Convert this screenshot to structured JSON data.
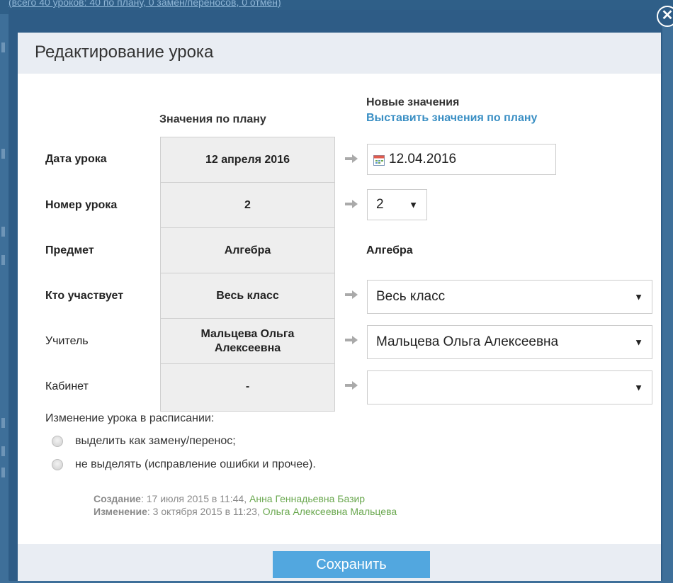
{
  "background": {
    "strip_text": "(всего 40 уроков: 40 по плану, 0 замен/переносов, 0 отмен)"
  },
  "dialog": {
    "title": "Редактирование урока",
    "close_label": "✕"
  },
  "columns": {
    "plan_header": "Значения по плану",
    "new_header": "Новые значения",
    "set_plan_link": "Выставить значения по плану"
  },
  "rows": [
    {
      "label": "Дата урока",
      "plan": "12 апреля 2016",
      "new": "12.04.2016"
    },
    {
      "label": "Номер урока",
      "plan": "2",
      "new": "2"
    },
    {
      "label": "Предмет",
      "plan": "Алгебра",
      "new": "Алгебра"
    },
    {
      "label": "Кто участвует",
      "plan": "Весь класс",
      "new": "Весь класс"
    },
    {
      "label": "Учитель",
      "plan": "Мальцева Ольга Алексеевна",
      "new": "Мальцева Ольга Алексеевна"
    },
    {
      "label": "Кабинет",
      "plan": "-",
      "new": ""
    }
  ],
  "schedule_change": {
    "title": "Изменение урока в расписании:",
    "options": [
      "выделить как замену/перенос;",
      "не выделять (исправление ошибки и прочее)."
    ]
  },
  "meta": {
    "created_label": "Создание",
    "created_value": ": 17 июля 2015 в 11:44, ",
    "created_by": "Анна Геннадьевна Базир",
    "modified_label": "Изменение",
    "modified_value": ": 3 октября 2015 в 11:23, ",
    "modified_by": "Ольга Алексеевна Мальцева"
  },
  "footer": {
    "save_label": "Сохранить"
  },
  "colors": {
    "accent": "#52a7df",
    "link": "#3a8fc4",
    "frame": "#2e5c86",
    "author": "#6aa84f"
  }
}
